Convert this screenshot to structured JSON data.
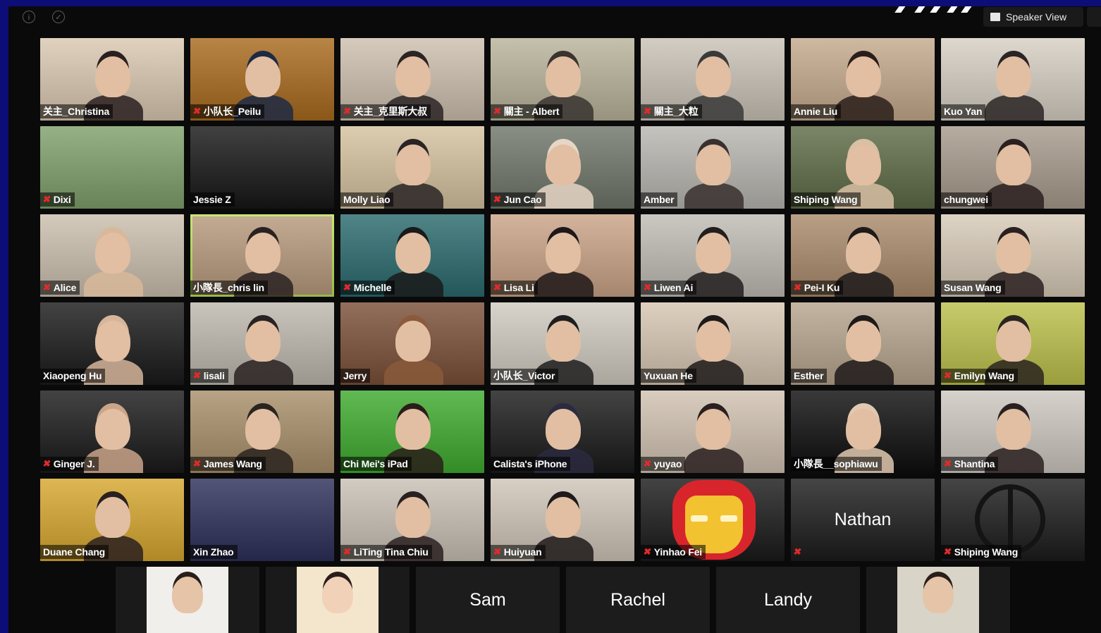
{
  "top_bar": {
    "info_icon": "info-icon",
    "shield_icon": "shield-check-icon",
    "speaker_view_label": "Speaker View"
  },
  "participants": [
    {
      "name": "关主_Christina",
      "muted": false,
      "bg": "#d9c8b0",
      "fg": "#2a2020"
    },
    {
      "name": "小队长_Peilu",
      "muted": true,
      "bg": "#a86a1e",
      "fg": "#1e2a44"
    },
    {
      "name": "关主_克里斯大叔",
      "muted": true,
      "bg": "#cdbfae",
      "fg": "#2a2424"
    },
    {
      "name": "關主 - Albert",
      "muted": true,
      "bg": "#b9b39a",
      "fg": "#3a3430"
    },
    {
      "name": "關主_大粒",
      "muted": true,
      "bg": "#c9c2b6",
      "fg": "#3a3a3a"
    },
    {
      "name": "Annie Liu",
      "muted": false,
      "bg": "#c4a98c",
      "fg": "#2a1e1a"
    },
    {
      "name": "Kuo Yan",
      "muted": false,
      "bg": "#d6cfc3",
      "fg": "#2a2424"
    },
    {
      "name": "Dixi",
      "muted": true,
      "bg": "#7fa06a",
      "fg": ""
    },
    {
      "name": "Jessie Z",
      "muted": false,
      "bg": "#171717",
      "fg": ""
    },
    {
      "name": "Molly Liao",
      "muted": false,
      "bg": "#d5c29f",
      "fg": "#2a2424"
    },
    {
      "name": "Jun Cao",
      "muted": true,
      "bg": "#6f766a",
      "fg": "#e6d6c6"
    },
    {
      "name": "Amber",
      "muted": false,
      "bg": "#b8b6b0",
      "fg": "#3a3030"
    },
    {
      "name": "Shiping Wang",
      "muted": false,
      "bg": "#5e6b46",
      "fg": "#d8c0a4"
    },
    {
      "name": "chungwei",
      "muted": false,
      "bg": "#a89a8c",
      "fg": "#2a2020"
    },
    {
      "name": "Alice",
      "muted": true,
      "bg": "#cbbfae",
      "fg": "#d8b89a"
    },
    {
      "name": "小隊長_chris lin",
      "muted": false,
      "bg": "#b79a7c",
      "fg": "#2a2222",
      "active": true
    },
    {
      "name": "Michelle",
      "muted": true,
      "bg": "#2a6a6e",
      "fg": "#1a1a1a"
    },
    {
      "name": "Lisa Li",
      "muted": true,
      "bg": "#caa386",
      "fg": "#1e1818"
    },
    {
      "name": "Liwen Ai",
      "muted": true,
      "bg": "#bfbcb4",
      "fg": "#221e1e"
    },
    {
      "name": "Pei-I Ku",
      "muted": true,
      "bg": "#a98a6a",
      "fg": "#1e1a1a"
    },
    {
      "name": "Susan Wang",
      "muted": false,
      "bg": "#d7cab7",
      "fg": "#2a2020"
    },
    {
      "name": "Xiaopeng Hu",
      "muted": false,
      "bg": "#1a1a1a",
      "fg": "#d6b59a"
    },
    {
      "name": "lisali",
      "muted": true,
      "bg": "#bdb8ae",
      "fg": "#2a2222"
    },
    {
      "name": "Jerry",
      "muted": false,
      "bg": "#7a5038",
      "fg": "#8a5a3a"
    },
    {
      "name": "小队长_Victor",
      "muted": false,
      "bg": "#cfcac0",
      "fg": "#1e1e1e"
    },
    {
      "name": "Yuxuan He",
      "muted": false,
      "bg": "#d7c6b2",
      "fg": "#1e1a1a"
    },
    {
      "name": "Esther",
      "muted": false,
      "bg": "#b7a48e",
      "fg": "#1e1a1a"
    },
    {
      "name": "Emilyn Wang",
      "muted": true,
      "bg": "#bcc04a",
      "fg": "#2a2420"
    },
    {
      "name": "Ginger J.",
      "muted": true,
      "bg": "#1a1a1a",
      "fg": "#caa58a"
    },
    {
      "name": "James Wang",
      "muted": true,
      "bg": "#a88f6a",
      "fg": "#2a2420"
    },
    {
      "name": "Chi Mei's iPad",
      "muted": false,
      "bg": "#3eaa2e",
      "fg": "#2a1e1a"
    },
    {
      "name": "Calista's iPhone",
      "muted": false,
      "bg": "#1a1a1a",
      "fg": "#2a2a40"
    },
    {
      "name": "yuyao",
      "muted": true,
      "bg": "#d1c2b2",
      "fg": "#2a2020"
    },
    {
      "name": "小隊長__sophiawu",
      "muted": false,
      "bg": "#0e0e0e",
      "fg": "#e0c9b0"
    },
    {
      "name": "Shantina",
      "muted": true,
      "bg": "#cdc7c0",
      "fg": "#2a2020"
    },
    {
      "name": "Duane Chang",
      "muted": false,
      "bg": "#d6a72e",
      "fg": "#2a2020"
    },
    {
      "name": "Xin Zhao",
      "muted": false,
      "bg": "#2d2f5a",
      "fg": ""
    },
    {
      "name": "LiTing Tina Chiu",
      "muted": true,
      "bg": "#c9c0b4",
      "fg": "#2a2020"
    },
    {
      "name": "Huiyuan",
      "muted": true,
      "bg": "#cfc5b8",
      "fg": "#1e1a1a"
    },
    {
      "name": "Yinhao Fei",
      "muted": true,
      "bg": "#1a1a1a",
      "fg": "",
      "avatar": "ironman"
    },
    {
      "name": "Nathan",
      "muted": true,
      "bg": "#1c1c1c",
      "fg": "",
      "blank": true
    },
    {
      "name": "Shiping Wang",
      "muted": true,
      "bg": "#1c1c1c",
      "fg": "",
      "avatar": "peace"
    }
  ],
  "bottom_row": [
    {
      "name": "",
      "bg": "#1a1a1a",
      "fg": "#f1efec",
      "kind": "photo"
    },
    {
      "name": "",
      "bg": "#1a1a1a",
      "fg": "#f4e6cc",
      "kind": "cartoon"
    },
    {
      "name": "Sam",
      "bg": "#1c1c1c",
      "kind": "blank"
    },
    {
      "name": "Rachel",
      "bg": "#1c1c1c",
      "kind": "blank"
    },
    {
      "name": "Landy",
      "bg": "#1c1c1c",
      "kind": "blank"
    },
    {
      "name": "",
      "bg": "#1a1a1a",
      "fg": "#d9d4c8",
      "kind": "photo"
    }
  ],
  "colors": {
    "frame": "#0d0d78",
    "background": "#0a0a0a",
    "active_speaker_border": "#b9e25a",
    "muted_icon": "#e02a2a"
  }
}
